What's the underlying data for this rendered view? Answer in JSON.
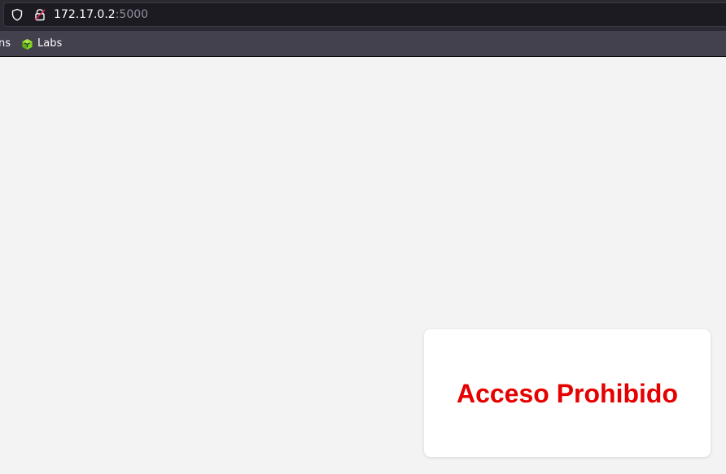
{
  "browser": {
    "url_host": "172.17.0.2",
    "url_port": ":5000",
    "icons": {
      "tracking_protection": "shield-icon",
      "connection": "insecure-lock-icon"
    }
  },
  "bookmarks": {
    "partial_item": "ns",
    "items": [
      {
        "label": "Labs",
        "icon": "cube-icon",
        "icon_color": "#7ed321"
      }
    ]
  },
  "page": {
    "background": "#f3f3f3",
    "card": {
      "title": "Acceso Prohibido",
      "title_color": "#e60000"
    }
  }
}
